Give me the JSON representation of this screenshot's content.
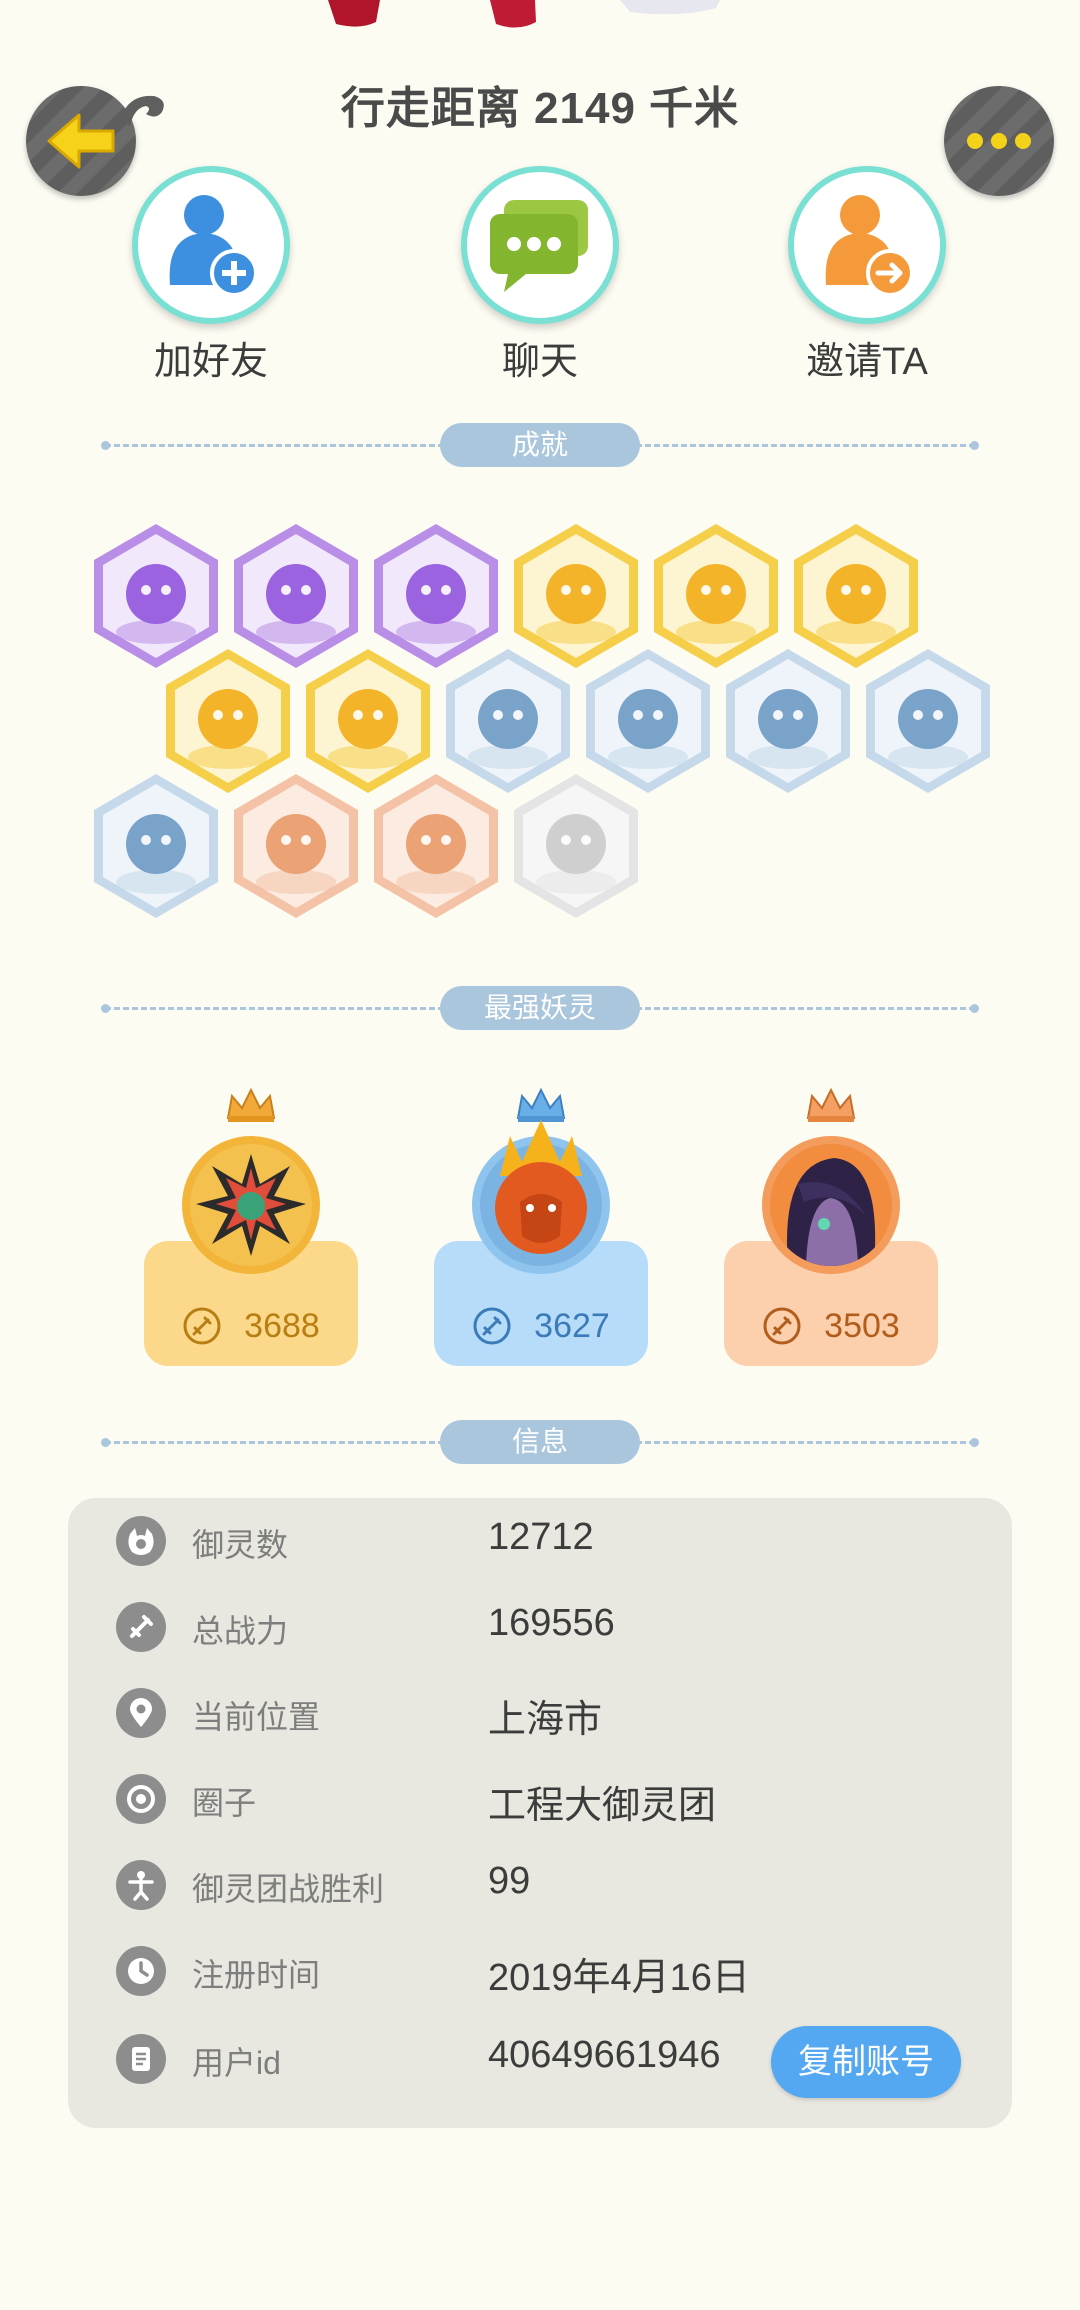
{
  "header": {
    "distance": "行走距离 2149 千米"
  },
  "actions": [
    {
      "label": "加好友",
      "icon": "add-friend-icon"
    },
    {
      "label": "聊天",
      "icon": "chat-icon"
    },
    {
      "label": "邀请TA",
      "icon": "invite-icon"
    }
  ],
  "sections": {
    "achievements": "成就",
    "strongest": "最强妖灵",
    "info": "信息"
  },
  "achievements": {
    "badges": [
      {
        "icon": "purple-demon-badge-icon",
        "tier": "purple"
      },
      {
        "icon": "yin-yang-swirl-badge-icon",
        "tier": "purple"
      },
      {
        "icon": "purple-cat-spirit-badge-icon",
        "tier": "purple"
      },
      {
        "icon": "sneaker-badge-icon",
        "tier": "gold"
      },
      {
        "icon": "sun-trophy-badge-icon",
        "tier": "gold"
      },
      {
        "icon": "gold-helmet-badge-icon",
        "tier": "gold"
      },
      {
        "icon": "taiji-scroll-badge-icon",
        "tier": "gold"
      },
      {
        "icon": "fox-book-badge-icon",
        "tier": "gold"
      },
      {
        "icon": "moon-badge-icon",
        "tier": "blue"
      },
      {
        "icon": "crystal-badge-icon",
        "tier": "blue"
      },
      {
        "icon": "frozen-figure-badge-icon",
        "tier": "blue"
      },
      {
        "icon": "dragon-fish-badge-icon",
        "tier": "blue"
      },
      {
        "icon": "shield-badge-icon",
        "tier": "blue"
      },
      {
        "icon": "bull-statue-badge-icon",
        "tier": "bronze"
      },
      {
        "icon": "pair-statue-badge-icon",
        "tier": "bronze"
      },
      {
        "icon": "cat-cart-badge-icon",
        "tier": "locked"
      }
    ]
  },
  "strongest": [
    {
      "power": "3688",
      "theme": "gold",
      "icon": "dark-spiked-spirit-avatar"
    },
    {
      "power": "3627",
      "theme": "blue",
      "icon": "flame-warrior-spirit-avatar"
    },
    {
      "power": "3503",
      "theme": "orange",
      "icon": "purple-hair-spirit-avatar"
    }
  ],
  "info": {
    "rows": [
      {
        "key": "御灵数",
        "value": "12712",
        "icon": "spirit-count-icon"
      },
      {
        "key": "总战力",
        "value": "169556",
        "icon": "sword-icon"
      },
      {
        "key": "当前位置",
        "value": "上海市",
        "icon": "location-pin-icon"
      },
      {
        "key": "圈子",
        "value": "工程大御灵团",
        "icon": "circle-target-icon"
      },
      {
        "key": "御灵团战胜利",
        "value": "99",
        "icon": "trophy-figure-icon"
      },
      {
        "key": "注册时间",
        "value": "2019年4月16日",
        "icon": "clock-icon"
      },
      {
        "key": "用户id",
        "value": "40649661946",
        "icon": "id-card-icon"
      }
    ],
    "copy_label": "复制账号"
  }
}
